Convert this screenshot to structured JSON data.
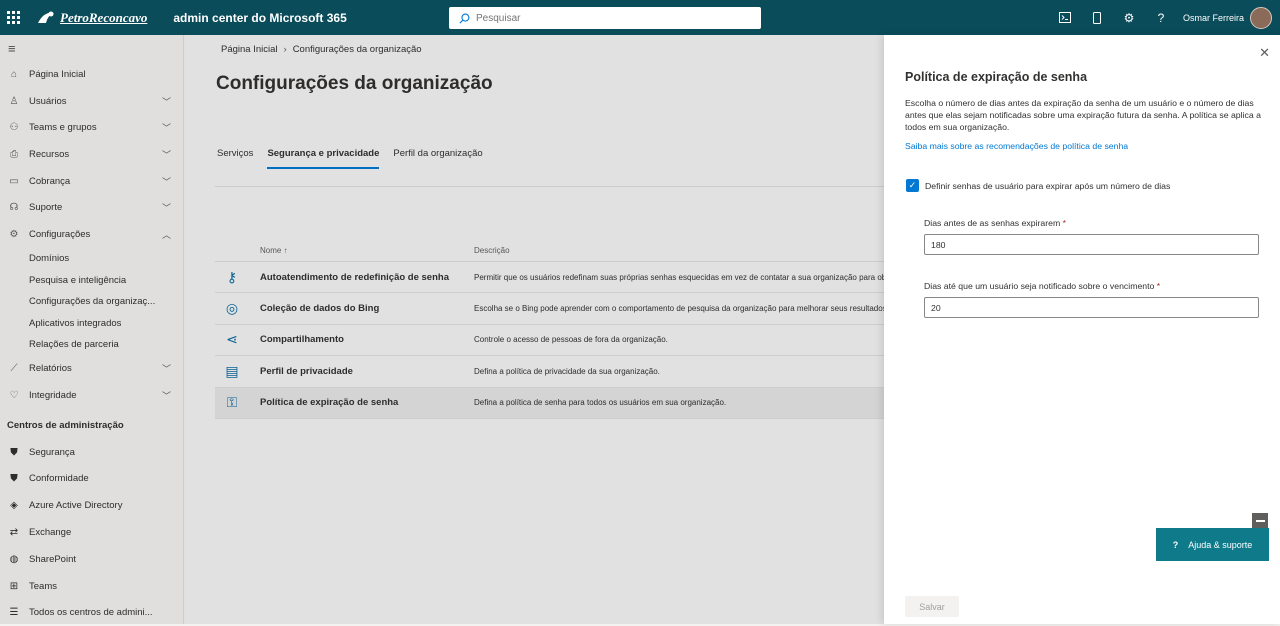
{
  "topbar": {
    "brand": "PetroReconcavo",
    "app_title": "admin center do Microsoft 365",
    "search_placeholder": "Pesquisar",
    "user_name": "Osmar Ferreira"
  },
  "sidebar": {
    "items": [
      {
        "label": "Página Inicial",
        "icon": "home-icon"
      },
      {
        "label": "Usuários",
        "icon": "user-icon",
        "chevron": "down"
      },
      {
        "label": "Teams e grupos",
        "icon": "teams-groups-icon",
        "chevron": "down"
      },
      {
        "label": "Recursos",
        "icon": "resources-icon",
        "chevron": "down"
      },
      {
        "label": "Cobrança",
        "icon": "billing-icon",
        "chevron": "down"
      },
      {
        "label": "Suporte",
        "icon": "headset-icon",
        "chevron": "down"
      },
      {
        "label": "Configurações",
        "icon": "gear-icon",
        "chevron": "up"
      }
    ],
    "subitems": [
      "Domínios",
      "Pesquisa e inteligência",
      "Configurações da organizaç...",
      "Aplicativos integrados",
      "Relações de parceria"
    ],
    "items_after": [
      {
        "label": "Relatórios",
        "icon": "chart-icon",
        "chevron": "down"
      },
      {
        "label": "Integridade",
        "icon": "heart-icon",
        "chevron": "down"
      }
    ],
    "admin_centers_title": "Centros de administração",
    "admin_centers": [
      {
        "label": "Segurança",
        "icon": "shield-icon"
      },
      {
        "label": "Conformidade",
        "icon": "compliance-icon"
      },
      {
        "label": "Azure Active Directory",
        "icon": "azure-ad-icon"
      },
      {
        "label": "Exchange",
        "icon": "exchange-icon"
      },
      {
        "label": "SharePoint",
        "icon": "sharepoint-icon"
      },
      {
        "label": "Teams",
        "icon": "teams-icon"
      },
      {
        "label": "Todos os centros de admini...",
        "icon": "list-icon"
      }
    ]
  },
  "main": {
    "breadcrumb": [
      "Página Inicial",
      "Configurações da organização"
    ],
    "title": "Configurações da organização",
    "tabs": [
      "Serviços",
      "Segurança e privacidade",
      "Perfil da organização"
    ],
    "active_tab": 1,
    "table": {
      "headers": [
        "Nome ↑",
        "Descrição"
      ],
      "rows": [
        {
          "name": "Autoatendimento de redefinição de senha",
          "desc": "Permitir que os usuários redefinam suas próprias senhas esquecidas em vez de contatar a sua organização para obter suporte.",
          "icon": "key-person-icon"
        },
        {
          "name": "Coleção de dados do Bing",
          "desc": "Escolha se o Bing pode aprender com o comportamento de pesquisa da organização para melhorar seus resultados.",
          "icon": "globe-icon"
        },
        {
          "name": "Compartilhamento",
          "desc": "Controle o acesso de pessoas de fora da organização.",
          "icon": "share-icon"
        },
        {
          "name": "Perfil de privacidade",
          "desc": "Defina a política de privacidade da sua organização.",
          "icon": "document-icon"
        },
        {
          "name": "Política de expiração de senha",
          "desc": "Defina a política de senha para todos os usuários em sua organização.",
          "icon": "key-icon"
        }
      ],
      "selected_row": 4
    }
  },
  "panel": {
    "title": "Política de expiração de senha",
    "description": "Escolha o número de dias antes da expiração da senha de um usuário e o número de dias antes que elas sejam notificadas sobre uma expiração futura da senha. A política se aplica a todos em sua organização.",
    "link": "Saiba mais sobre as recomendações de política de senha",
    "checkbox_label": "Definir senhas de usuário para expirar após um número de dias",
    "checkbox_checked": true,
    "field1_label": "Dias antes de as senhas expirarem",
    "field1_value": "180",
    "field2_label": "Dias até que um usuário seja notificado sobre o vencimento",
    "field2_value": "20",
    "required_mark": "*",
    "help_button": "Ajuda & suporte",
    "save_button": "Salvar"
  }
}
